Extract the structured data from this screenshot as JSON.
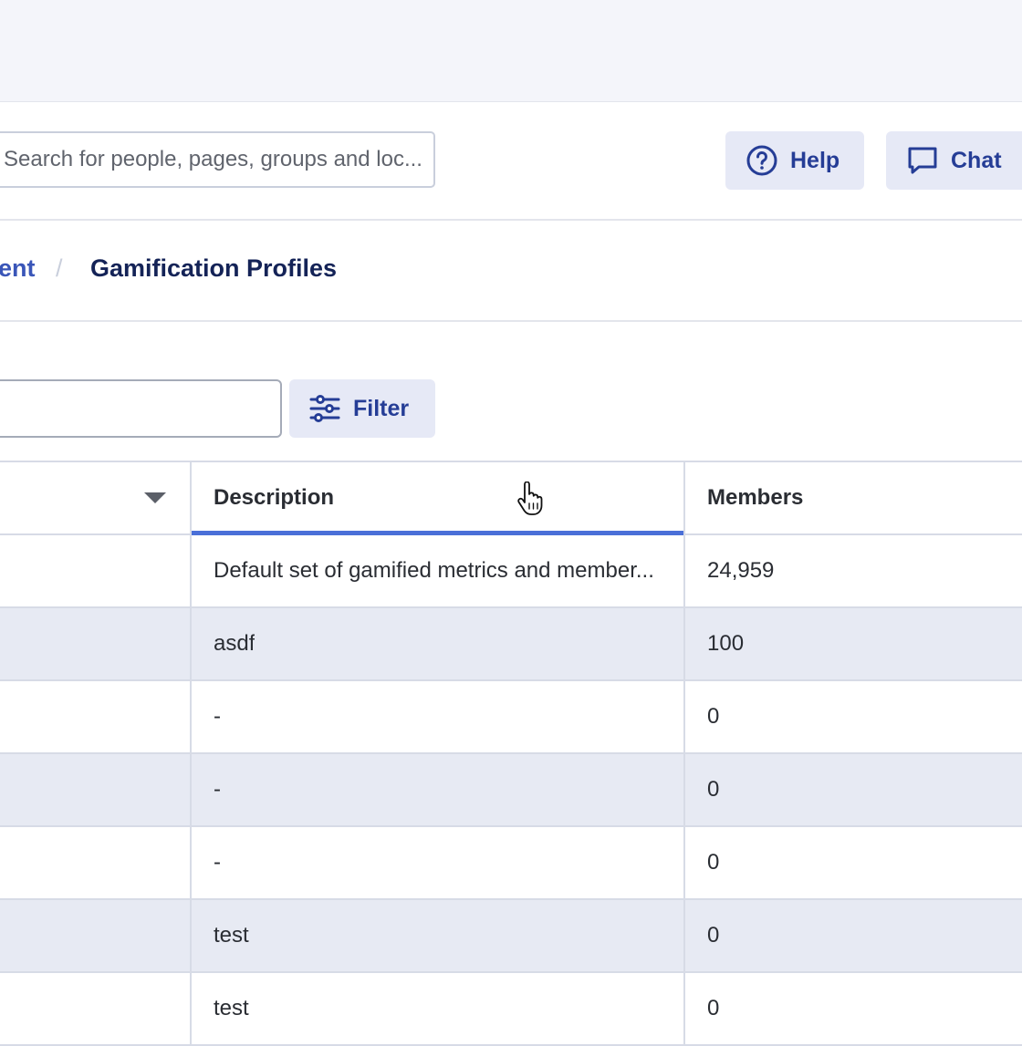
{
  "header": {
    "search_placeholder": "Search for people, pages, groups and loc...",
    "help_label": "Help",
    "chat_label": "Chat"
  },
  "breadcrumb": {
    "parent": "ent",
    "separator": "/",
    "current": "Gamification Profiles"
  },
  "toolbar": {
    "filter_label": "Filter"
  },
  "table": {
    "columns": {
      "description": "Description",
      "members": "Members"
    },
    "rows": [
      {
        "description": "Default set of gamified metrics and member...",
        "members": "24,959"
      },
      {
        "description": "asdf",
        "members": "100"
      },
      {
        "description": "-",
        "members": "0"
      },
      {
        "description": "-",
        "members": "0"
      },
      {
        "description": "-",
        "members": "0"
      },
      {
        "description": "test",
        "members": "0"
      },
      {
        "description": "test",
        "members": "0"
      }
    ]
  },
  "colors": {
    "accent": "#253d96",
    "button_bg": "#e6e9f6",
    "row_alt": "#e7eaf3",
    "active_column_underline": "#4a6fd8"
  },
  "icons": {
    "help": "question-circle-icon",
    "chat": "chat-bubble-icon",
    "filter": "sliders-icon",
    "sort": "caret-down-icon"
  }
}
